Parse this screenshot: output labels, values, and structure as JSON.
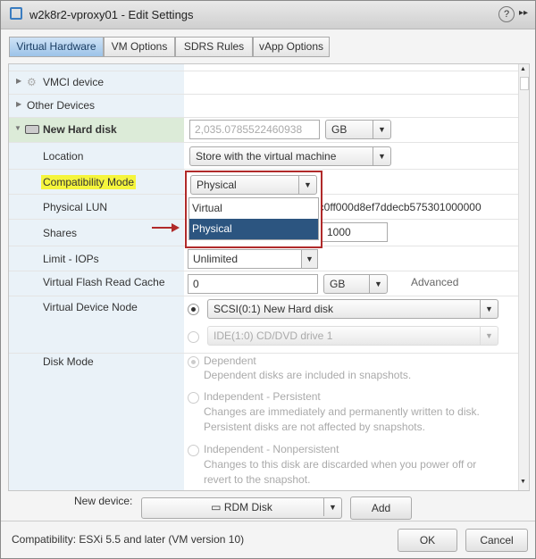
{
  "window": {
    "title": "w2k8r2-vproxy01 - Edit Settings",
    "help_icon": "?",
    "expand_icon": "▸▸"
  },
  "tabs": [
    {
      "label": "Virtual Hardware",
      "active": true
    },
    {
      "label": "VM Options"
    },
    {
      "label": "SDRS Rules"
    },
    {
      "label": "vApp Options"
    }
  ],
  "rows": {
    "vmci": "VMCI device",
    "other": "Other Devices",
    "disk": {
      "label": "New Hard disk",
      "size": "2,035.0785522460938",
      "unit": "GB"
    },
    "location": {
      "label": "Location",
      "value": "Store with the virtual machine"
    },
    "compat": {
      "label": "Compatibility Mode",
      "value": "Physical",
      "options": [
        "Virtual",
        "Physical"
      ],
      "selected": "Physical"
    },
    "lun": {
      "label": "Physical LUN",
      "value": "0c0ff000d8ef7ddecb575301000000"
    },
    "shares": {
      "label": "Shares",
      "value": "1000"
    },
    "limit": {
      "label": "Limit - IOPs",
      "value": "Unlimited"
    },
    "flash": {
      "label": "Virtual Flash Read Cache",
      "value": "0",
      "unit": "GB",
      "advanced": "Advanced"
    },
    "vdn": {
      "label": "Virtual Device Node",
      "scsi": "SCSI(0:1) New Hard disk",
      "ide": "IDE(1:0) CD/DVD drive 1"
    },
    "diskmode": {
      "label": "Disk Mode",
      "options": [
        {
          "title": "Dependent",
          "desc": "Dependent disks are included in snapshots."
        },
        {
          "title": "Independent - Persistent",
          "desc": "Changes are immediately and permanently written to disk. Persistent disks are not affected by snapshots."
        },
        {
          "title": "Independent - Nonpersistent",
          "desc": "Changes to this disk are discarded when you power off or revert to the snapshot."
        }
      ]
    }
  },
  "footer": {
    "new_device_label": "New device:",
    "new_device_value": "RDM Disk",
    "add": "Add",
    "compatibility": "Compatibility: ESXi 5.5 and later (VM version 10)",
    "ok": "OK",
    "cancel": "Cancel"
  },
  "colors": {
    "highlight": "#f5f53c",
    "callout": "#b02a2a",
    "selected": "#2c5580"
  }
}
